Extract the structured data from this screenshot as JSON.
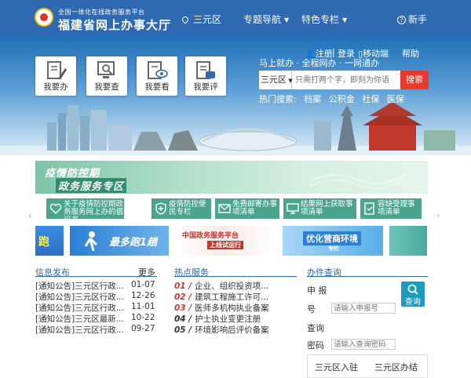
{
  "header": {
    "logo_small": "全国一体化在线政务服务平台",
    "logo_big": "福建省网上办事大厅",
    "region": "三元区",
    "nav_topics": "专题导航",
    "nav_special": "特色专栏",
    "nav_newbie": "新手"
  },
  "banner": {
    "quick_buttons": [
      {
        "label": "我要办",
        "icon": "pen-doc-icon"
      },
      {
        "label": "我要查",
        "icon": "magnifier-doc-icon"
      },
      {
        "label": "我要看",
        "icon": "eye-doc-icon"
      },
      {
        "label": "我要评",
        "icon": "edit-doc-icon"
      }
    ],
    "register": "注册",
    "login": "登录",
    "mobile": "移动端",
    "help": "帮助",
    "slogan": "马上就办 · 全程网办 · 一网通办",
    "search_region": "三元区",
    "search_placeholder": "只需打两个字，即刻为你语",
    "search_button": "搜索",
    "hot_label": "热门搜索:",
    "hot_keywords": [
      "档案",
      "公积金",
      "社保",
      "医保"
    ]
  },
  "epidemic": {
    "title": "疫情防控期",
    "subtitle": "政务服务专区",
    "services": [
      {
        "text": "关于疫情防控期政务服务网上办的倡议书",
        "icon": "heart-icon"
      },
      {
        "text": "疫情防控便民专栏",
        "icon": "shield-plus-icon"
      },
      {
        "text": "免费邮寄办事项清单",
        "icon": "mail-icon"
      },
      {
        "text": "结果网上获取事项清单",
        "icon": "monitor-icon"
      },
      {
        "text": "容缺受理事项清单",
        "icon": "doc-check-icon"
      }
    ]
  },
  "ads": {
    "ad1": "跑",
    "ad2": "最多跑1趟",
    "ad3_line1": "中国政务服务平台",
    "ad3_line2": "上线试运行",
    "ad4": "优化营商环境",
    "ad4_sub": "专栏"
  },
  "info": {
    "title": "信息发布",
    "more": "更多",
    "items": [
      {
        "title": "[通知公告]三元区行政...",
        "date": "01-07"
      },
      {
        "title": "[通知公告]三元区行政...",
        "date": "12-26"
      },
      {
        "title": "[通知公告]三元区行政...",
        "date": "11-01"
      },
      {
        "title": "[通知公告]三元区最新...",
        "date": "10-22"
      },
      {
        "title": "[通知公告]三元区行政...",
        "date": "09-27"
      }
    ]
  },
  "hot_services": {
    "title": "热点服务",
    "items": [
      {
        "num": "01 /",
        "text": "企业、组织投资项..."
      },
      {
        "num": "02 /",
        "text": "建筑工程施工许可..."
      },
      {
        "num": "03 /",
        "text": "医师多机构执业备案"
      },
      {
        "num": "04 /",
        "text": "护士执业变更注册"
      },
      {
        "num": "05 /",
        "text": "环境影响后评价备案"
      }
    ]
  },
  "query": {
    "title": "办件查询",
    "apply_label_1": "申 报",
    "apply_label_2": "号",
    "apply_placeholder": "请输入申报号",
    "query_label": "查询",
    "pwd_label": "密码",
    "pwd_placeholder": "请输入查询密码",
    "button": "查询",
    "tab1": "三元区入驻",
    "tab2": "三元区办结"
  },
  "colors": {
    "nav_bg": "#2e69b1",
    "accent_red": "#e8392f",
    "service_green": "#4aa58c",
    "query_blue": "#1a9cc0"
  }
}
